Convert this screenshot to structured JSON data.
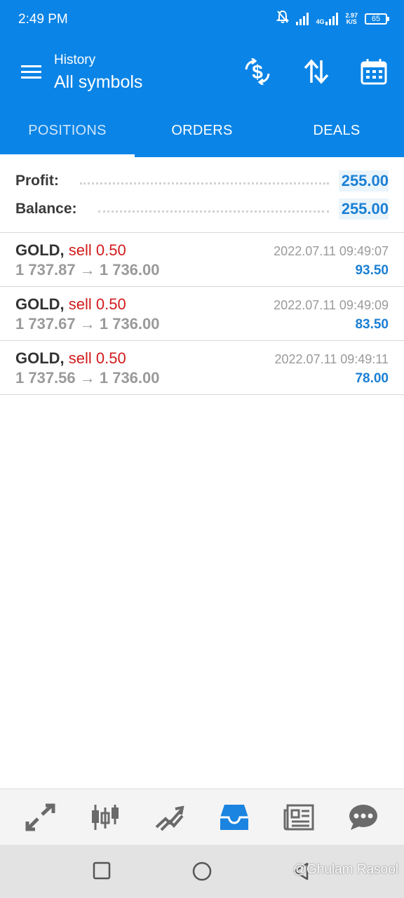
{
  "status_bar": {
    "time": "2:49 PM",
    "network": "4G",
    "speed_value": "2.97",
    "speed_unit": "K/S",
    "battery": "65"
  },
  "app_bar": {
    "subtitle": "History",
    "title": "All symbols",
    "icons": [
      "menu-icon",
      "dollar-sync-icon",
      "sort-icon",
      "calendar-icon"
    ]
  },
  "tabs": [
    {
      "label": "POSITIONS",
      "active": true
    },
    {
      "label": "ORDERS",
      "active": false
    },
    {
      "label": "DEALS",
      "active": false
    }
  ],
  "summary": {
    "profit_label": "Profit:",
    "profit_value": "255.00",
    "balance_label": "Balance:",
    "balance_value": "255.00"
  },
  "positions": [
    {
      "symbol": "GOLD,",
      "side": "sell 0.50",
      "prices": "1 737.87 → 1 736.00",
      "time": "2022.07.11 09:49:07",
      "profit": "93.50"
    },
    {
      "symbol": "GOLD,",
      "side": "sell 0.50",
      "prices": "1 737.67 → 1 736.00",
      "time": "2022.07.11 09:49:09",
      "profit": "83.50"
    },
    {
      "symbol": "GOLD,",
      "side": "sell 0.50",
      "prices": "1 737.56 → 1 736.00",
      "time": "2022.07.11 09:49:11",
      "profit": "78.00"
    }
  ],
  "bottom_nav": {
    "items": [
      "quotes-icon",
      "chart-icon",
      "trade-icon",
      "history-icon",
      "news-icon",
      "messages-icon"
    ],
    "active": "history-icon",
    "active_color": "#1a84e0",
    "inactive_color": "#6a6a6a"
  },
  "watermark": "@Ghulam Rasool",
  "colors": {
    "primary": "#0a84e6",
    "sell": "#d21b1b",
    "profit": "#1a7fd4"
  }
}
